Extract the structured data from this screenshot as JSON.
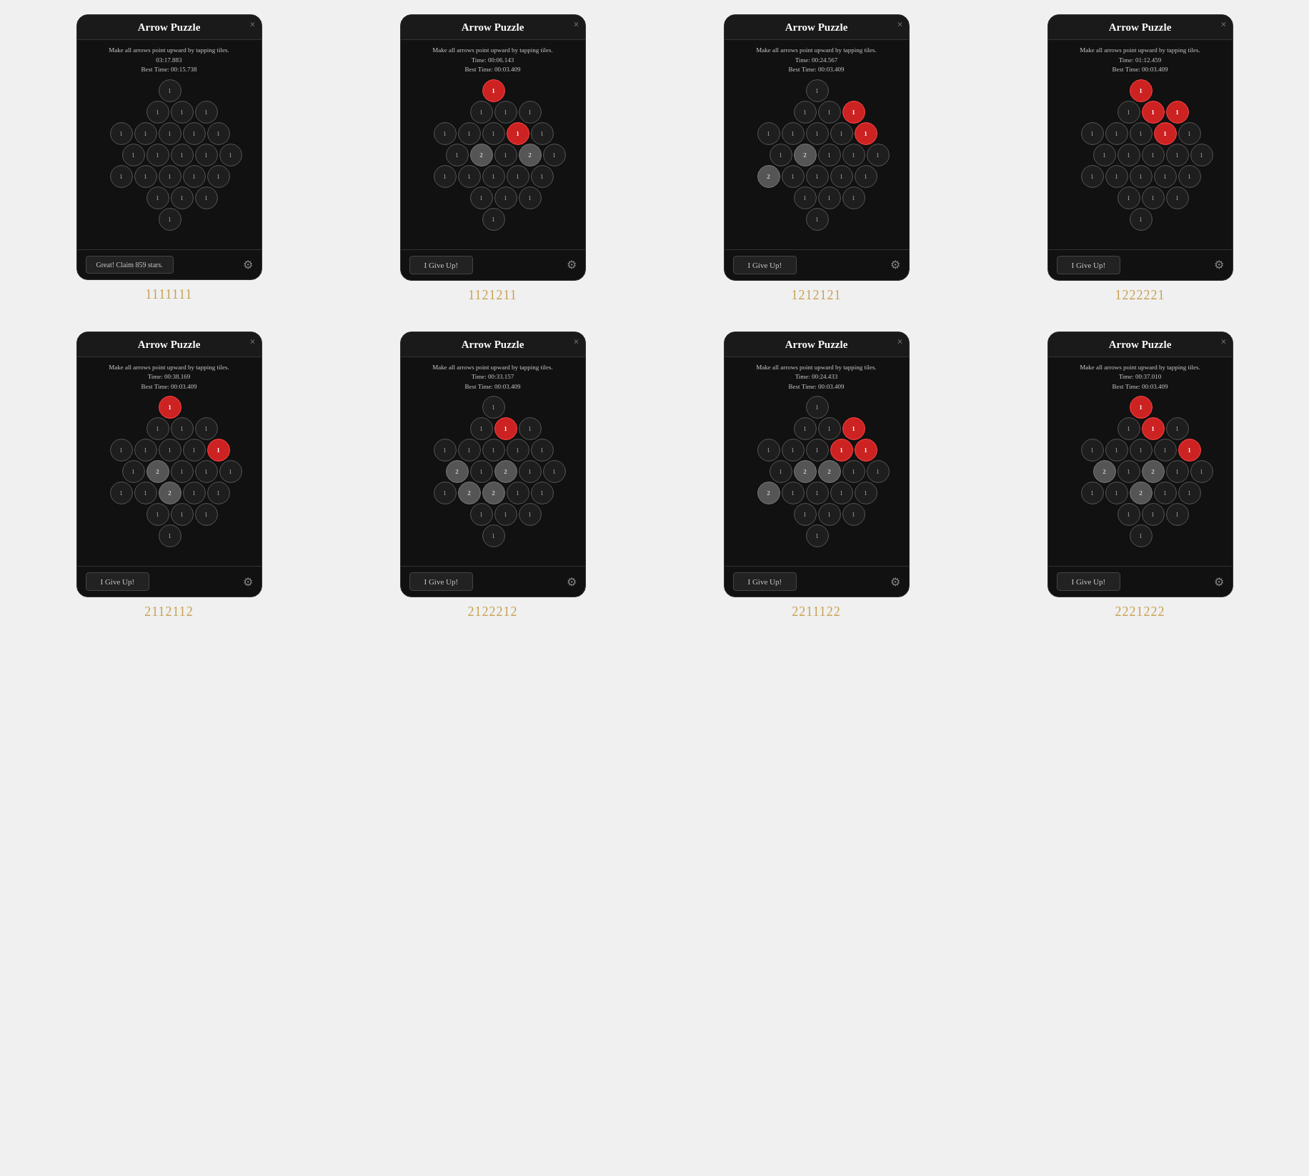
{
  "puzzles": [
    {
      "id": "p1",
      "title": "Arrow Puzzle",
      "instruction": "Make all arrows point upward by tapping tiles.",
      "time": null,
      "displayTime": "03:17.883",
      "bestTime": "00:15.738",
      "showTime": false,
      "footer": "Great! Claim 859 stars.",
      "footerType": "great",
      "label": "1111111",
      "layout": "1111111"
    },
    {
      "id": "p2",
      "title": "Arrow Puzzle",
      "instruction": "Make all arrows point upward by tapping tiles.",
      "displayTime": "00:06.143",
      "bestTime": "00:03.409",
      "showTime": true,
      "footer": "I Give Up!",
      "footerType": "giveup",
      "label": "1121211",
      "layout": "1121211"
    },
    {
      "id": "p3",
      "title": "Arrow Puzzle",
      "instruction": "Make all arrows point upward by tapping tiles.",
      "displayTime": "00:24.567",
      "bestTime": "00:03.409",
      "showTime": true,
      "footer": "I Give Up!",
      "footerType": "giveup",
      "label": "1212121",
      "layout": "1212121"
    },
    {
      "id": "p4",
      "title": "Arrow Puzzle",
      "instruction": "Make all arrows point upward by tapping tiles.",
      "displayTime": "01:12.459",
      "bestTime": "00:03.409",
      "showTime": true,
      "footer": "I Give Up!",
      "footerType": "giveup",
      "label": "1222221",
      "layout": "1222221"
    },
    {
      "id": "p5",
      "title": "Arrow Puzzle",
      "instruction": "Make all arrows point upward by tapping tiles.",
      "displayTime": "00:38.169",
      "bestTime": "00:03.409",
      "showTime": true,
      "footer": "I Give Up!",
      "footerType": "giveup",
      "label": "2112112",
      "layout": "2112112"
    },
    {
      "id": "p6",
      "title": "Arrow Puzzle",
      "instruction": "Make all arrows point upward by tapping tiles.",
      "displayTime": "00:33.157",
      "bestTime": "00:03.409",
      "showTime": true,
      "footer": "I Give Up!",
      "footerType": "giveup",
      "label": "2122212",
      "layout": "2122212"
    },
    {
      "id": "p7",
      "title": "Arrow Puzzle",
      "instruction": "Make all arrows point upward by tapping tiles.",
      "displayTime": "00:24.433",
      "bestTime": "00:03.409",
      "showTime": true,
      "footer": "I Give Up!",
      "footerType": "giveup",
      "label": "2211122",
      "layout": "2211122"
    },
    {
      "id": "p8",
      "title": "Arrow Puzzle",
      "instruction": "Make all arrows point upward by tapping tiles.",
      "displayTime": "00:37.010",
      "bestTime": "00:03.409",
      "showTime": true,
      "footer": "I Give Up!",
      "footerType": "giveup",
      "label": "2221222",
      "layout": "2221222"
    }
  ],
  "close_label": "×",
  "gear_symbol": "⚙",
  "time_prefix": "Time: ",
  "best_prefix": "Best Time: "
}
